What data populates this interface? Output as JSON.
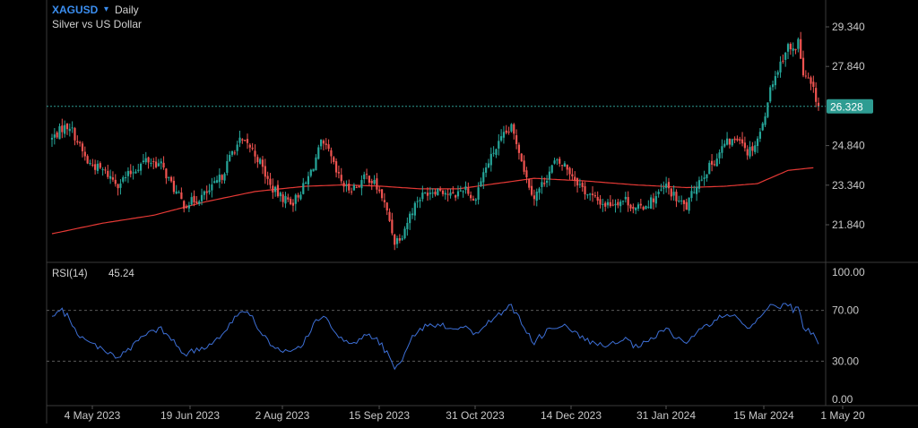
{
  "header": {
    "symbol": "XAGUSD",
    "caret": "▾",
    "timeframe": "Daily",
    "description": "Silver vs US Dollar"
  },
  "price_axis": {
    "ticks": [
      {
        "value": 29.34,
        "label": "29.340"
      },
      {
        "value": 27.84,
        "label": "27.840"
      },
      {
        "value": 24.84,
        "label": "24.840"
      },
      {
        "value": 23.34,
        "label": "23.340"
      },
      {
        "value": 21.84,
        "label": "21.840"
      }
    ],
    "last_price": {
      "value": 26.328,
      "label": "26.328"
    }
  },
  "rsi": {
    "label": "RSI(14)",
    "value": "45.24",
    "ticks": [
      {
        "value": 100,
        "label": "100.00"
      },
      {
        "value": 70,
        "label": "70.00"
      },
      {
        "value": 30,
        "label": "30.00"
      },
      {
        "value": 0,
        "label": "0.00"
      }
    ],
    "levels": [
      70,
      30
    ]
  },
  "time_axis": [
    "4 May 2023",
    "19 Jun 2023",
    "2 Aug 2023",
    "15 Sep 2023",
    "31 Oct 2023",
    "14 Dec 2023",
    "31 Jan 2024",
    "15 Mar 2024",
    "1 May 20"
  ],
  "colors": {
    "background": "#000000",
    "up": "#26a69a",
    "down": "#ef5350",
    "moving_average": "#e53935",
    "rsi_line": "#3d6fd6",
    "last_price_line": "#2e9c92",
    "symbol": "#3b8ef0"
  },
  "chart_data": {
    "type": "candlestick",
    "price_range": [
      20.6,
      30.0
    ],
    "rsi_range": [
      0,
      100
    ],
    "price_path": [
      [
        0,
        25.1
      ],
      [
        4,
        25.5
      ],
      [
        7,
        25.6
      ],
      [
        10,
        25.0
      ],
      [
        14,
        24.2
      ],
      [
        20,
        23.9
      ],
      [
        26,
        23.4
      ],
      [
        31,
        23.8
      ],
      [
        37,
        24.3
      ],
      [
        43,
        24.1
      ],
      [
        48,
        23.2
      ],
      [
        52,
        22.6
      ],
      [
        57,
        22.8
      ],
      [
        62,
        23.1
      ],
      [
        67,
        23.7
      ],
      [
        71,
        24.6
      ],
      [
        74,
        25.0
      ],
      [
        78,
        24.8
      ],
      [
        82,
        24.2
      ],
      [
        86,
        23.3
      ],
      [
        90,
        22.9
      ],
      [
        95,
        22.7
      ],
      [
        100,
        23.4
      ],
      [
        103,
        24.1
      ],
      [
        106,
        24.9
      ],
      [
        109,
        24.6
      ],
      [
        112,
        23.8
      ],
      [
        116,
        23.2
      ],
      [
        120,
        23.3
      ],
      [
        124,
        23.7
      ],
      [
        127,
        23.4
      ],
      [
        130,
        22.9
      ],
      [
        133,
        22.0
      ],
      [
        135,
        21.2
      ],
      [
        138,
        21.5
      ],
      [
        141,
        22.2
      ],
      [
        144,
        22.8
      ],
      [
        148,
        23.1
      ],
      [
        153,
        23.2
      ],
      [
        158,
        22.9
      ],
      [
        163,
        23.3
      ],
      [
        166,
        22.7
      ],
      [
        170,
        23.8
      ],
      [
        174,
        24.6
      ],
      [
        178,
        25.2
      ],
      [
        181,
        25.5
      ],
      [
        184,
        24.7
      ],
      [
        187,
        23.6
      ],
      [
        190,
        22.9
      ],
      [
        194,
        23.5
      ],
      [
        198,
        24.2
      ],
      [
        202,
        24.1
      ],
      [
        206,
        23.6
      ],
      [
        210,
        23.1
      ],
      [
        214,
        22.8
      ],
      [
        218,
        22.6
      ],
      [
        222,
        22.7
      ],
      [
        226,
        22.8
      ],
      [
        230,
        22.4
      ],
      [
        234,
        22.6
      ],
      [
        238,
        22.9
      ],
      [
        242,
        23.3
      ],
      [
        246,
        22.8
      ],
      [
        250,
        22.5
      ],
      [
        254,
        23.4
      ],
      [
        258,
        23.9
      ],
      [
        262,
        24.4
      ],
      [
        265,
        24.9
      ],
      [
        268,
        25.0
      ],
      [
        271,
        25.2
      ],
      [
        274,
        24.6
      ],
      [
        277,
        24.9
      ],
      [
        280,
        25.6
      ],
      [
        282,
        26.6
      ],
      [
        284,
        27.3
      ],
      [
        286,
        27.7
      ],
      [
        288,
        28.2
      ],
      [
        290,
        28.6
      ],
      [
        292,
        28.4
      ],
      [
        294,
        28.8
      ],
      [
        296,
        27.5
      ],
      [
        298,
        27.3
      ],
      [
        300,
        26.9
      ],
      [
        302,
        26.33
      ]
    ],
    "sma": [
      [
        0,
        21.5
      ],
      [
        20,
        21.9
      ],
      [
        40,
        22.2
      ],
      [
        60,
        22.7
      ],
      [
        80,
        23.1
      ],
      [
        100,
        23.3
      ],
      [
        115,
        23.35
      ],
      [
        130,
        23.3
      ],
      [
        145,
        23.2
      ],
      [
        160,
        23.2
      ],
      [
        175,
        23.4
      ],
      [
        190,
        23.6
      ],
      [
        210,
        23.5
      ],
      [
        230,
        23.35
      ],
      [
        250,
        23.25
      ],
      [
        265,
        23.3
      ],
      [
        278,
        23.4
      ],
      [
        290,
        23.9
      ],
      [
        300,
        24.0
      ]
    ],
    "rsi_path": [
      [
        0,
        64
      ],
      [
        4,
        70
      ],
      [
        7,
        63
      ],
      [
        10,
        52
      ],
      [
        14,
        45
      ],
      [
        20,
        40
      ],
      [
        26,
        33
      ],
      [
        31,
        40
      ],
      [
        37,
        52
      ],
      [
        43,
        55
      ],
      [
        48,
        45
      ],
      [
        52,
        36
      ],
      [
        57,
        38
      ],
      [
        62,
        43
      ],
      [
        67,
        52
      ],
      [
        71,
        61
      ],
      [
        74,
        70
      ],
      [
        78,
        66
      ],
      [
        82,
        55
      ],
      [
        86,
        43
      ],
      [
        90,
        37
      ],
      [
        95,
        37
      ],
      [
        100,
        47
      ],
      [
        103,
        58
      ],
      [
        106,
        65
      ],
      [
        109,
        62
      ],
      [
        112,
        53
      ],
      [
        116,
        44
      ],
      [
        120,
        45
      ],
      [
        124,
        52
      ],
      [
        127,
        49
      ],
      [
        130,
        42
      ],
      [
        133,
        33
      ],
      [
        135,
        26
      ],
      [
        138,
        33
      ],
      [
        141,
        45
      ],
      [
        144,
        54
      ],
      [
        148,
        58
      ],
      [
        153,
        59
      ],
      [
        158,
        56
      ],
      [
        163,
        58
      ],
      [
        166,
        50
      ],
      [
        170,
        57
      ],
      [
        174,
        64
      ],
      [
        178,
        70
      ],
      [
        181,
        73
      ],
      [
        184,
        64
      ],
      [
        187,
        52
      ],
      [
        190,
        45
      ],
      [
        194,
        52
      ],
      [
        198,
        58
      ],
      [
        202,
        57
      ],
      [
        206,
        52
      ],
      [
        210,
        47
      ],
      [
        214,
        44
      ],
      [
        218,
        41
      ],
      [
        222,
        44
      ],
      [
        226,
        47
      ],
      [
        230,
        41
      ],
      [
        234,
        44
      ],
      [
        238,
        50
      ],
      [
        242,
        55
      ],
      [
        246,
        49
      ],
      [
        250,
        44
      ],
      [
        254,
        53
      ],
      [
        258,
        58
      ],
      [
        262,
        63
      ],
      [
        265,
        66
      ],
      [
        268,
        65
      ],
      [
        271,
        63
      ],
      [
        274,
        56
      ],
      [
        277,
        60
      ],
      [
        280,
        69
      ],
      [
        282,
        73
      ],
      [
        284,
        74
      ],
      [
        286,
        72
      ],
      [
        288,
        74
      ],
      [
        290,
        75
      ],
      [
        292,
        70
      ],
      [
        294,
        72
      ],
      [
        296,
        56
      ],
      [
        298,
        54
      ],
      [
        300,
        52
      ],
      [
        302,
        45
      ]
    ]
  }
}
